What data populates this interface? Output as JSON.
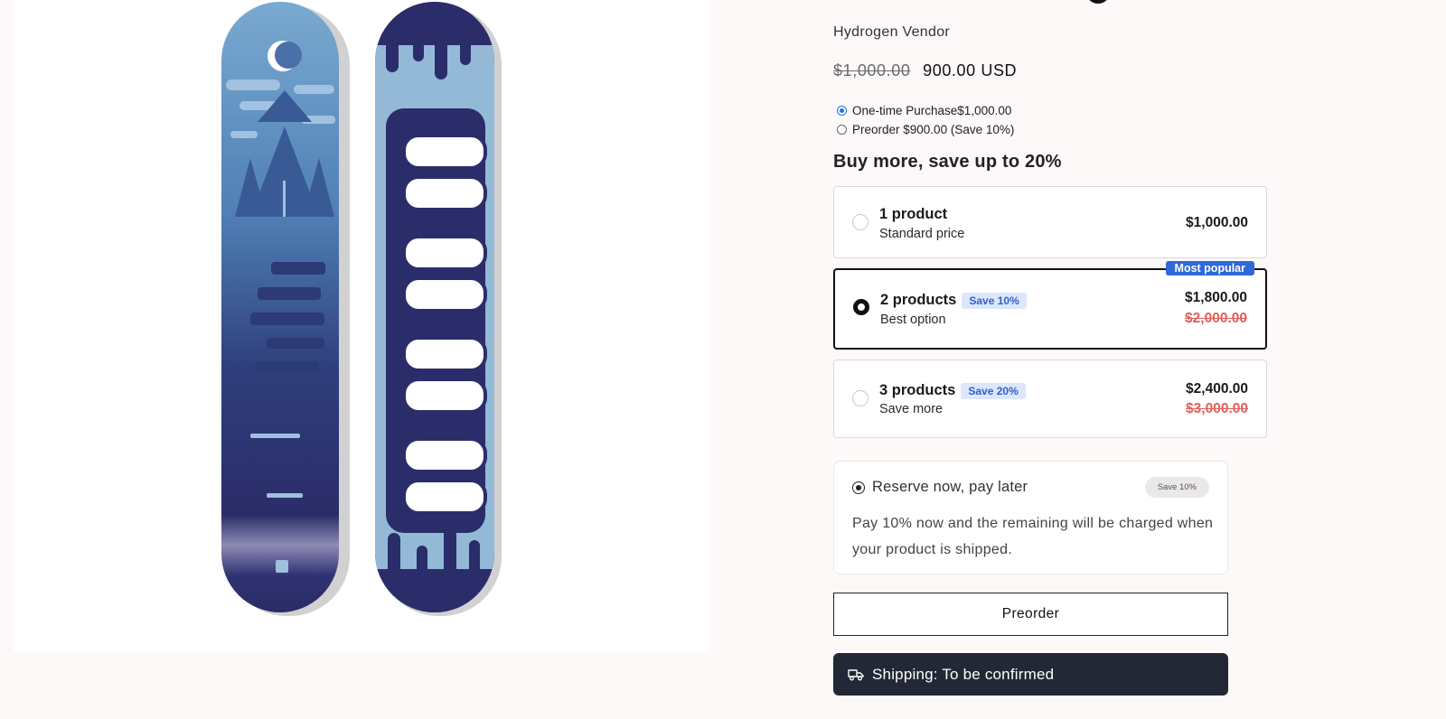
{
  "product": {
    "vendor": "Hydrogen Vendor",
    "compare_price": "$1,000.00",
    "price": "900.00 USD"
  },
  "purchase_options": [
    {
      "label": "One-time Purchase$1,000.00",
      "selected": true
    },
    {
      "label": "Preorder $900.00 (Save 10%)",
      "selected": false
    }
  ],
  "bundles": {
    "title": "Buy more, save up to 20%",
    "options": [
      {
        "title": "1 product",
        "subtitle": "Standard price",
        "price": "$1,000.00",
        "compare": "",
        "badge": "",
        "selected": false
      },
      {
        "title": "2 products",
        "subtitle": "Best option",
        "price": "$1,800.00",
        "compare": "$2,000.00",
        "badge": "Save 10%",
        "ribbon": "Most popular",
        "selected": true
      },
      {
        "title": "3 products",
        "subtitle": "Save more",
        "price": "$2,400.00",
        "compare": "$3,000.00",
        "badge": "Save 20%",
        "selected": false
      }
    ]
  },
  "reserve": {
    "title": "Reserve now, pay later",
    "badge": "Save 10%",
    "description": "Pay 10% now and the remaining will be charged when your product is shipped."
  },
  "actions": {
    "preorder_label": "Preorder",
    "shipping_label": "Shipping: To be confirmed"
  },
  "colors": {
    "accent": "#2f68d8",
    "dark": "#232836",
    "strike_red": "#e0605e",
    "board_navy": "#2c2f6b",
    "board_light": "#8fb4d4"
  }
}
